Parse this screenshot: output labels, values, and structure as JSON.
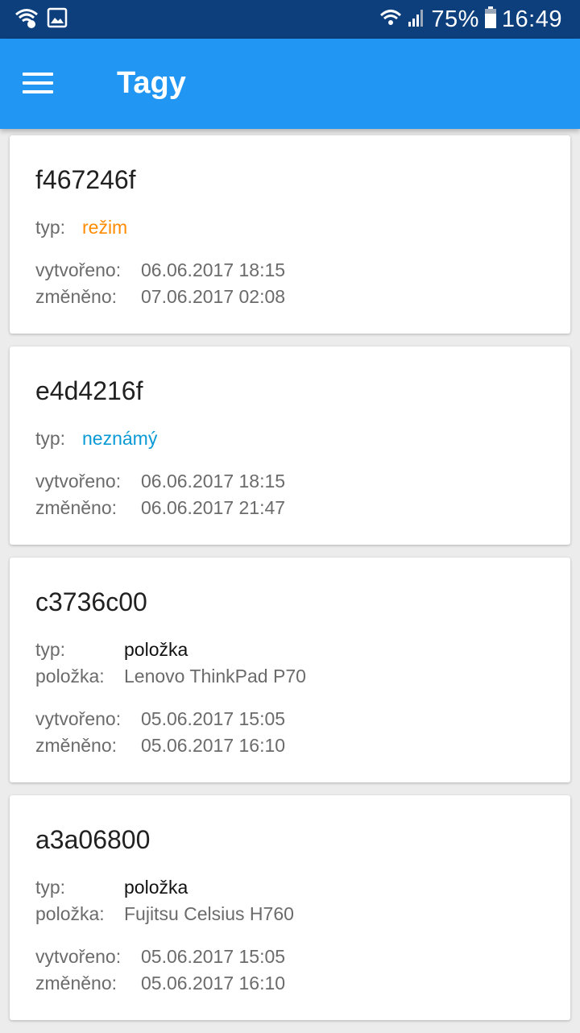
{
  "status_bar": {
    "icons_left": [
      "wifi-call-icon",
      "image-icon"
    ],
    "icons_right": [
      "wifi-icon",
      "signal-icon",
      "battery-icon"
    ],
    "battery": "75%",
    "time": "16:49"
  },
  "app_bar": {
    "title": "Tagy",
    "menu_icon": "hamburger-menu-icon"
  },
  "tags": [
    {
      "id": "f467246f",
      "type_label": "typ:",
      "type_value": "režim",
      "type_color": "#ff8c00",
      "created_label": "vytvořeno:",
      "created": "06.06.2017 18:15",
      "modified_label": "změněno:",
      "modified": "07.06.2017 02:08"
    },
    {
      "id": "e4d4216f",
      "type_label": "typ:",
      "type_value": "neznámý",
      "type_color": "#0a9ad6",
      "created_label": "vytvořeno:",
      "created": "06.06.2017 18:15",
      "modified_label": "změněno:",
      "modified": "06.06.2017 21:47"
    },
    {
      "id": "c3736c00",
      "type_label": "typ:",
      "type_value": "položka",
      "type_color": "#111111",
      "item_label": "položka:",
      "item_value": "Lenovo ThinkPad P70",
      "created_label": "vytvořeno:",
      "created": "05.06.2017 15:05",
      "modified_label": "změněno:",
      "modified": "05.06.2017 16:10"
    },
    {
      "id": "a3a06800",
      "type_label": "typ:",
      "type_value": "položka",
      "type_color": "#111111",
      "item_label": "položka:",
      "item_value": "Fujitsu Celsius H760",
      "created_label": "vytvořeno:",
      "created": "05.06.2017 15:05",
      "modified_label": "změněno:",
      "modified": "05.06.2017 16:10"
    }
  ]
}
